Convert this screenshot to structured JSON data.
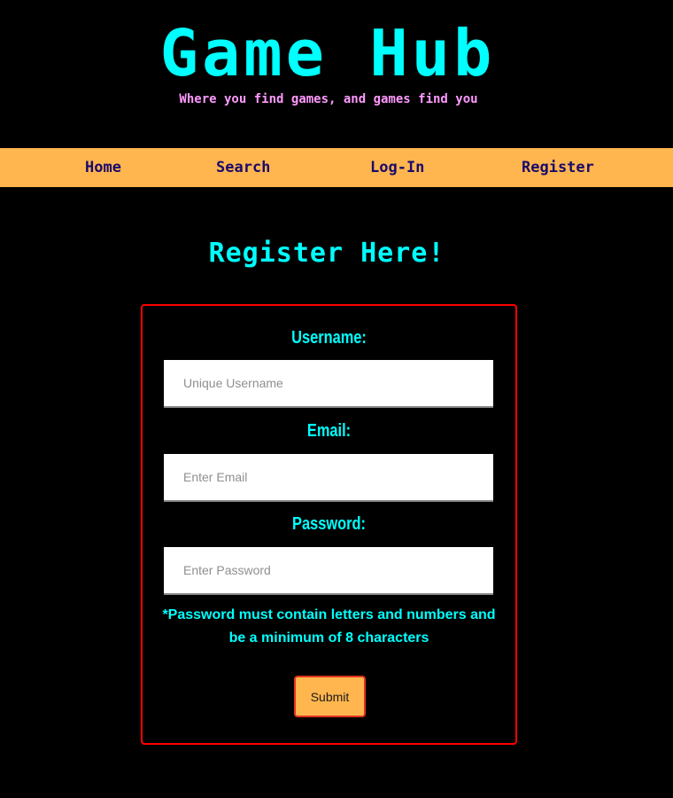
{
  "header": {
    "title": "Game Hub",
    "tagline": "Where you find games, and games find you"
  },
  "nav": {
    "items": [
      {
        "label": "Home"
      },
      {
        "label": "Search"
      },
      {
        "label": "Log-In"
      },
      {
        "label": "Register"
      }
    ]
  },
  "page": {
    "heading": "Register Here!"
  },
  "form": {
    "username": {
      "label": "Username:",
      "placeholder": "Unique Username",
      "value": ""
    },
    "email": {
      "label": "Email:",
      "placeholder": "Enter Email",
      "value": ""
    },
    "password": {
      "label": "Password:",
      "placeholder": "Enter Password",
      "value": ""
    },
    "password_note": "*Password must contain letters and numbers and be a minimum of 8 characters",
    "submit_label": "Submit"
  },
  "colors": {
    "background": "#000000",
    "accent_cyan": "#00FFFF",
    "tagline_pink": "#FF99FF",
    "nav_background": "#FFB64F",
    "nav_text": "#1A0A6B",
    "form_border": "#FF0000"
  }
}
